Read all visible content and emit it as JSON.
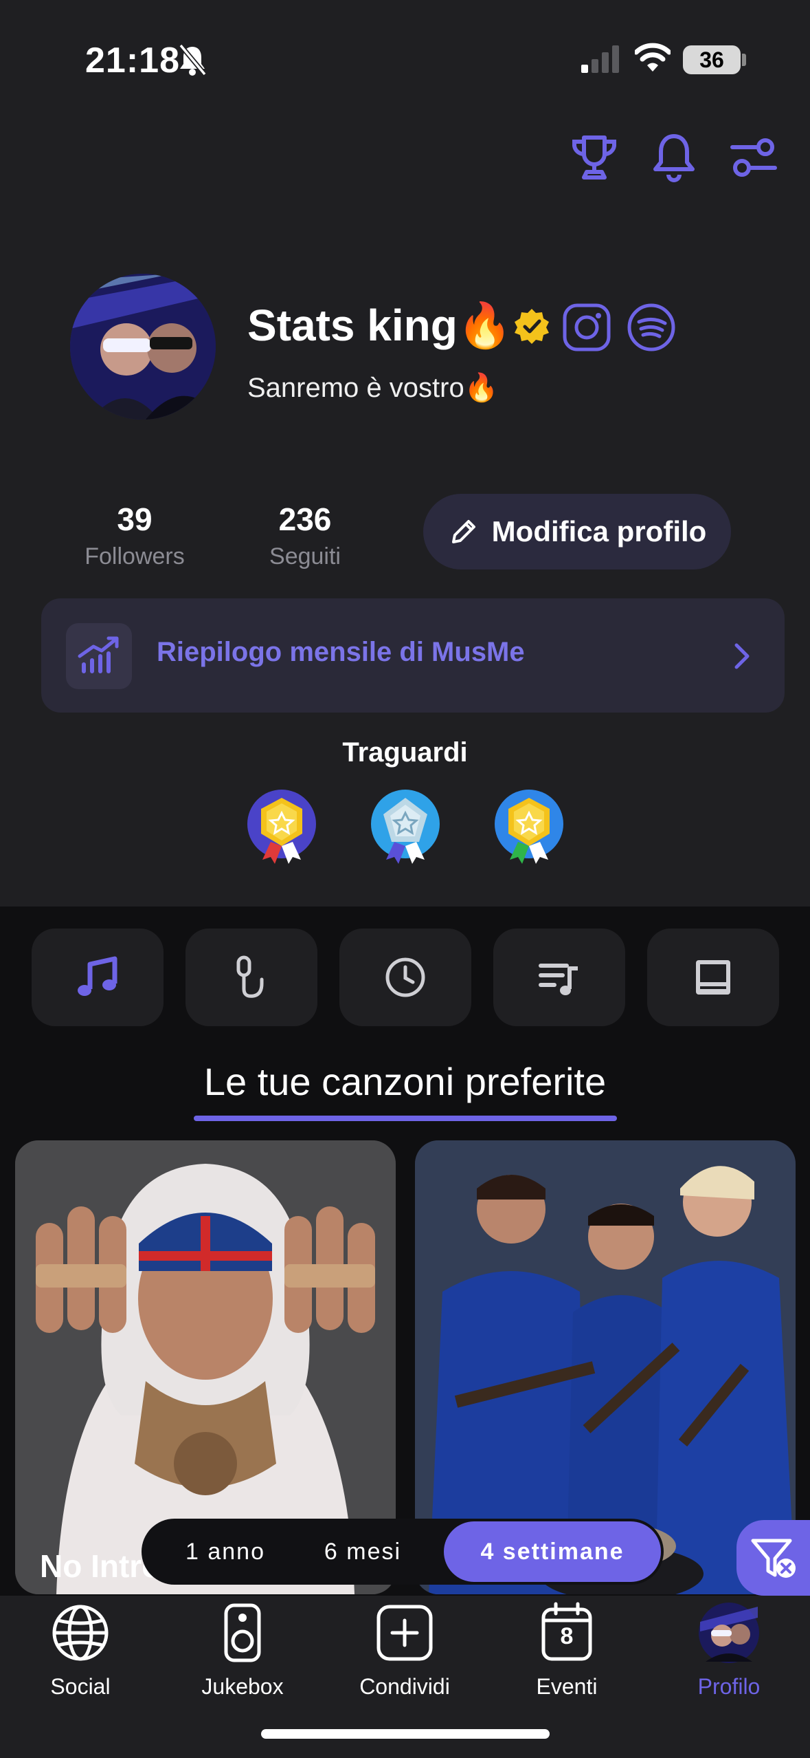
{
  "status_bar": {
    "time": "21:18",
    "battery": "36"
  },
  "profile": {
    "name": "Stats king🔥",
    "bio": "Sanremo è vostro🔥",
    "followers_count": "39",
    "followers_label": "Followers",
    "following_count": "236",
    "following_label": "Seguiti",
    "edit_button": "Modifica profilo"
  },
  "recap": {
    "label": "Riepilogo mensile di MusMe"
  },
  "achievements": {
    "title": "Traguardi"
  },
  "tabs": {
    "section_title": "Le tue canzoni preferite"
  },
  "songs": [
    {
      "title": "No Introduction"
    }
  ],
  "period": {
    "options": [
      "1 anno",
      "6 mesi",
      "4 settimane"
    ],
    "selected": "4 settimane"
  },
  "nav": {
    "social": "Social",
    "jukebox": "Jukebox",
    "share": "Condividi",
    "events": "Eventi",
    "events_day": "8",
    "profile": "Profilo"
  },
  "colors": {
    "accent": "#6e64e6",
    "gold": "#f4c21b"
  }
}
